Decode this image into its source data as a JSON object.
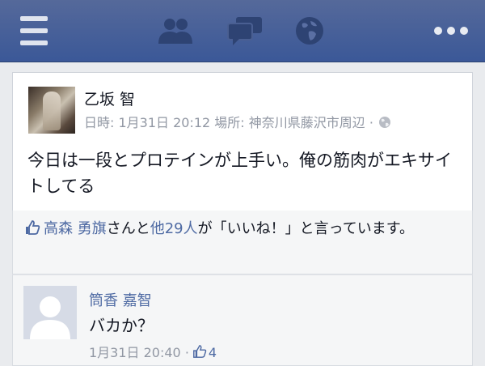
{
  "topbar": {
    "icons": [
      "menu-icon",
      "friend-requests-icon",
      "messages-icon",
      "notifications-globe-icon",
      "more-icon"
    ],
    "bg_color": "#3b5898"
  },
  "post": {
    "author": "乙坂 智",
    "meta": "日時: 1月31日 20:12 場所: 神奈川県藤沢市周辺 ·",
    "text": "今日は一段とプロテインが上手い。俺の筋肉がエキサイトしてる"
  },
  "likes": {
    "name": "高森 勇旗",
    "middle": "さんと",
    "others": "他29人",
    "suffix": "が「いいね！」と言っています。"
  },
  "comment": {
    "author": "筒香 嘉智",
    "text": "バカか？",
    "time": "1月31日 20:40 ·",
    "like_count": "4"
  },
  "colors": {
    "link": "#4e6aa3",
    "meta": "#9197a3",
    "text": "#141823"
  }
}
